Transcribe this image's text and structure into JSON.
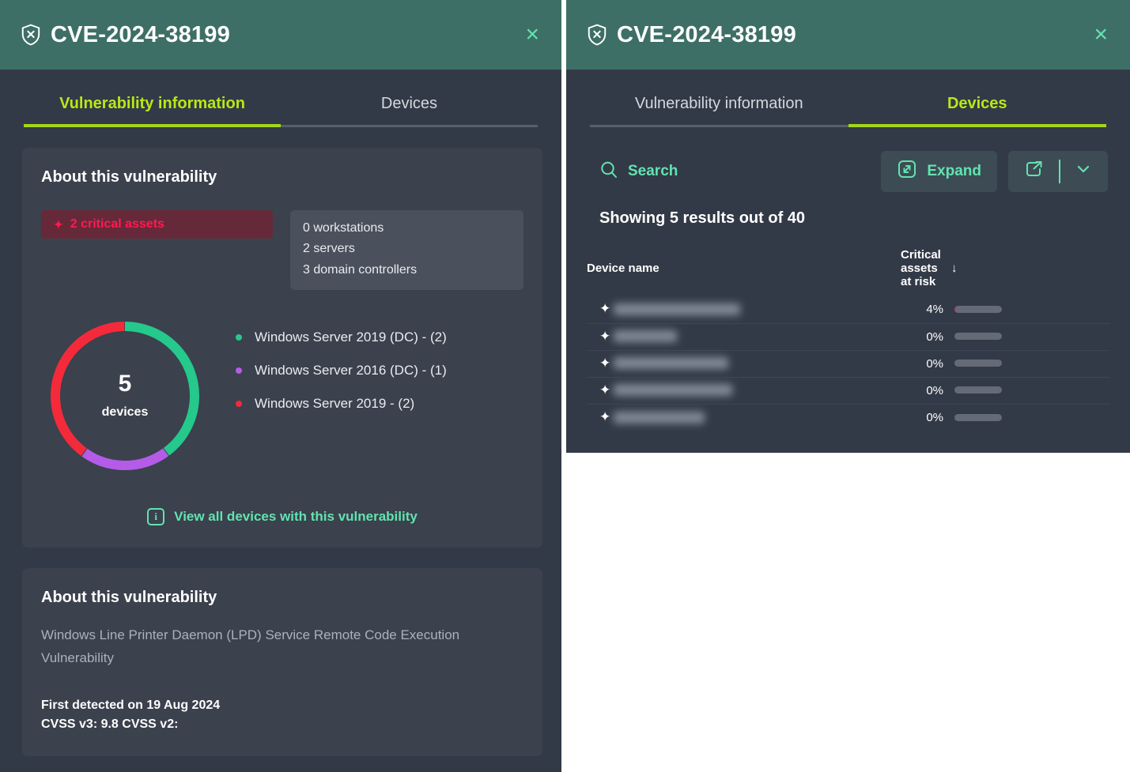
{
  "header": {
    "icon": "shield-x-icon",
    "title": "CVE-2024-38199",
    "close_label": "×",
    "bg_color": "#3e6f66",
    "accent_color": "#62e3b0"
  },
  "left_panel": {
    "tabs": [
      {
        "label": "Vulnerability information",
        "active": true
      },
      {
        "label": "Devices",
        "active": false
      }
    ],
    "about_card": {
      "heading": "About this vulnerability",
      "critical_badge": {
        "icon": "diamond-icon",
        "label": "2 critical assets",
        "text_color": "#ff1a4f",
        "bg_color": "#66293a"
      },
      "counts": [
        "0 workstations",
        "2 servers",
        "3 domain controllers"
      ],
      "view_all_link": {
        "icon": "info-icon",
        "label": "View all devices with this vulnerability"
      }
    },
    "details_card": {
      "heading": "About this vulnerability",
      "description": "Windows Line Printer Daemon (LPD) Service Remote Code Execution Vulnerability",
      "first_detected": "First detected on 19 Aug 2024",
      "cvss": "CVSS v3: 9.8    CVSS v2:"
    }
  },
  "right_panel": {
    "tabs": [
      {
        "label": "Vulnerability information",
        "active": false
      },
      {
        "label": "Devices",
        "active": true
      }
    ],
    "toolbar": {
      "search_icon": "search-icon",
      "search_label": "Search",
      "expand_icon": "expand-arrow-icon",
      "expand_label": "Expand",
      "export_icon": "export-icon",
      "chevron_icon": "chevron-down-icon"
    },
    "showing": "Showing 5 results out of 40",
    "table": {
      "columns": [
        "Device name",
        "Critical assets at risk"
      ],
      "sort_icon": "arrow-down-icon",
      "rows": [
        {
          "icon": "diamond-icon",
          "device_name": "",
          "redacted_width": 160,
          "percent": "4%",
          "bar_value": 4
        },
        {
          "icon": "diamond-icon",
          "device_name": "",
          "redacted_width": 80,
          "percent": "0%",
          "bar_value": 0
        },
        {
          "icon": "diamond-icon",
          "device_name": "",
          "redacted_width": 145,
          "percent": "0%",
          "bar_value": 0
        },
        {
          "icon": "diamond-icon",
          "device_name": "",
          "redacted_width": 150,
          "percent": "0%",
          "bar_value": 0
        },
        {
          "icon": "diamond-icon",
          "device_name": "",
          "redacted_width": 115,
          "percent": "0%",
          "bar_value": 0
        }
      ]
    }
  },
  "chart_data": {
    "type": "pie",
    "title": "Devices by operating system",
    "center_value": "5",
    "center_label": "devices",
    "total": 5,
    "categories": [
      "Windows Server 2019 (DC)  - (2)",
      "Windows Server 2016 (DC)  - (1)",
      "Windows Server 2019  - (2)"
    ],
    "values": [
      2,
      1,
      2
    ],
    "percentages": [
      40,
      20,
      40
    ],
    "colors": [
      "#24c98b",
      "#b45ce8",
      "#f42a3b"
    ],
    "legend_position": "right",
    "grid": false
  }
}
